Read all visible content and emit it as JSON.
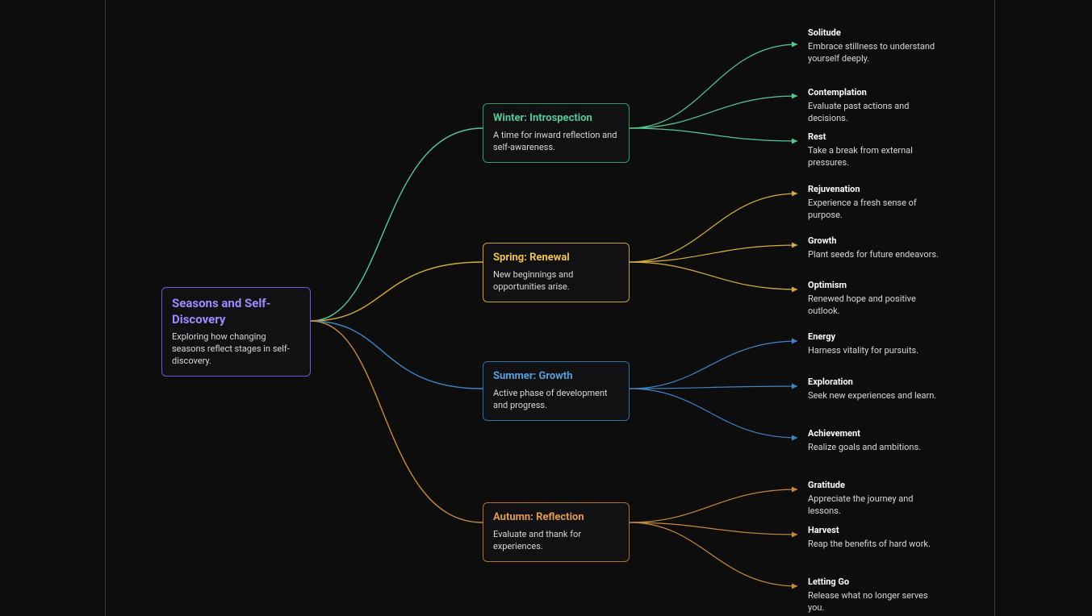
{
  "root": {
    "title": "Seasons and Self-Discovery",
    "desc": "Exploring how changing seasons reflect stages in self-discovery."
  },
  "seasons": [
    {
      "key": "winter",
      "title": "Winter: Introspection",
      "desc": "A time for inward reflection and self-awareness.",
      "color": "#57c997",
      "leaves": [
        {
          "title": "Solitude",
          "desc": "Embrace stillness to understand yourself deeply."
        },
        {
          "title": "Contemplation",
          "desc": "Evaluate past actions and decisions."
        },
        {
          "title": "Rest",
          "desc": "Take a break from external pressures."
        }
      ]
    },
    {
      "key": "spring",
      "title": "Spring: Renewal",
      "desc": "New beginnings and opportunities arise.",
      "color": "#d6ad3a",
      "leaves": [
        {
          "title": "Rejuvenation",
          "desc": "Experience a fresh sense of purpose."
        },
        {
          "title": "Growth",
          "desc": "Plant seeds for future endeavors."
        },
        {
          "title": "Optimism",
          "desc": "Renewed hope and positive outlook."
        }
      ]
    },
    {
      "key": "summer",
      "title": "Summer: Growth",
      "desc": "Active phase of development and progress.",
      "color": "#3f85c8",
      "leaves": [
        {
          "title": "Energy",
          "desc": "Harness vitality for pursuits."
        },
        {
          "title": "Exploration",
          "desc": "Seek new experiences and learn."
        },
        {
          "title": "Achievement",
          "desc": "Realize goals and ambitions."
        }
      ]
    },
    {
      "key": "autumn",
      "title": "Autumn: Reflection",
      "desc": "Evaluate and thank for experiences.",
      "color": "#c98a3f",
      "leaves": [
        {
          "title": "Gratitude",
          "desc": "Appreciate the journey and lessons."
        },
        {
          "title": "Harvest",
          "desc": "Reap the benefits of hard work."
        },
        {
          "title": "Letting Go",
          "desc": "Release what no longer serves you."
        }
      ]
    }
  ]
}
